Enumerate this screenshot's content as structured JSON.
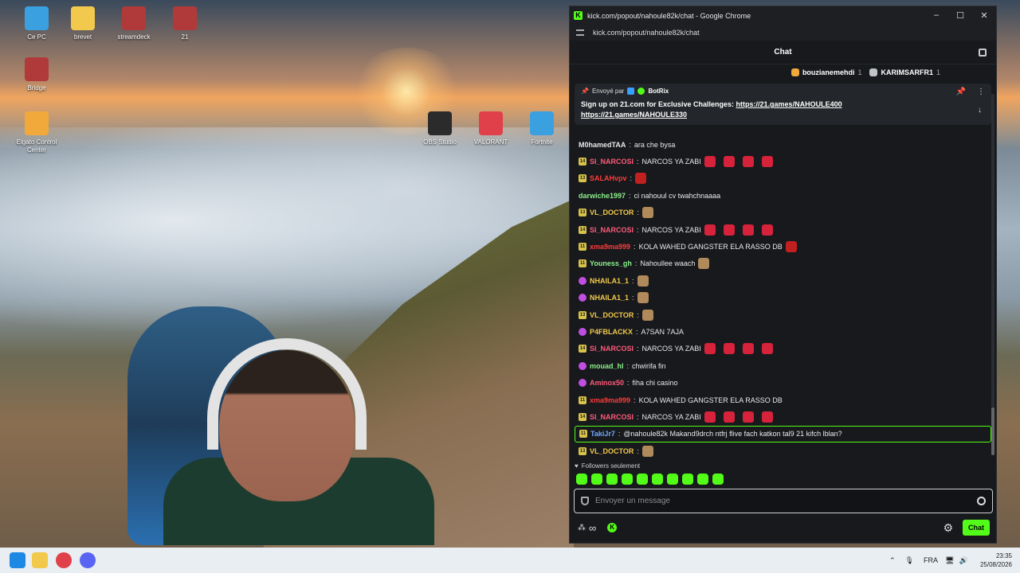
{
  "desktop": {
    "icons": [
      {
        "label": "Ce PC",
        "color": "#3aa0e0"
      },
      {
        "label": "brevet",
        "color": "#f2c94c"
      },
      {
        "label": "streamdeck",
        "color": "#b03a3a"
      },
      {
        "label": "21",
        "color": "#b03a3a"
      },
      {
        "label": "Bridge",
        "color": "#b03a3a"
      },
      {
        "label": "Elgato Control Center",
        "color": "#f2a93b"
      },
      {
        "label": "OBS Studio",
        "color": "#2b2b2b"
      },
      {
        "label": "VALORANT",
        "color": "#e0404a"
      },
      {
        "label": "Fortnite",
        "color": "#3aa0e0"
      }
    ]
  },
  "browser": {
    "title": "kick.com/popout/nahoule82k/chat - Google Chrome",
    "url": "kick.com/popout/nahoule82k/chat"
  },
  "chat": {
    "header_title": "Chat",
    "leaderboard": [
      {
        "name": "bouzianemehdi",
        "rank": "1",
        "color": "#f2a93b"
      },
      {
        "name": "KARIMSARFR1",
        "rank": "1",
        "color": "#c0c4c8"
      }
    ],
    "pinned": {
      "sent_by": "Envoyé par",
      "author": "BotRix",
      "text": "Sign up on 21.com for Exclusive Challenges: ",
      "link1": "https://21.games/NAHOULE400",
      "link2": "https://21.games/NAHOULE330"
    },
    "messages": [
      {
        "badge": "",
        "user": "M0hamedTAA",
        "color": "#e8e8e8",
        "text": "ara che bysa",
        "emotes": 0
      },
      {
        "badge": "14",
        "user": "SI_NARCOSI",
        "color": "#ff5a7a",
        "text": "NARCOS YA ZABI",
        "emotes": 4
      },
      {
        "badge": "13",
        "user": "SALAHvpv",
        "color": "#ff3b3b",
        "text": "",
        "emotes": 1
      },
      {
        "badge": "",
        "user": "darwiche1997",
        "color": "#8cf08c",
        "text": "ci nahouul cv twahchnaaaa",
        "emotes": 0
      },
      {
        "badge": "13",
        "user": "VL_DOCTOR",
        "color": "#f2c94c",
        "text": "",
        "emotes": 1
      },
      {
        "badge": "14",
        "user": "SI_NARCOSI",
        "color": "#ff5a7a",
        "text": "NARCOS YA ZABI",
        "emotes": 4
      },
      {
        "badge": "11",
        "user": "xma9ma999",
        "color": "#ff3b3b",
        "text": "KOLA WAHED GANGSTER ELA RASSO DB",
        "emotes": 1
      },
      {
        "badge": "11",
        "user": "Youness_gh",
        "color": "#8cf08c",
        "text": "Nahoullee waach",
        "emotes": 1
      },
      {
        "badge": "p",
        "user": "NHAILA1_1",
        "color": "#f2c94c",
        "text": "",
        "emotes": 1
      },
      {
        "badge": "p",
        "user": "NHAILA1_1",
        "color": "#f2c94c",
        "text": "",
        "emotes": 1
      },
      {
        "badge": "13",
        "user": "VL_DOCTOR",
        "color": "#f2c94c",
        "text": "",
        "emotes": 1
      },
      {
        "badge": "p",
        "user": "P4FBLACKX",
        "color": "#f2c94c",
        "text": "A7SAN 7AJA",
        "emotes": 0
      },
      {
        "badge": "14",
        "user": "SI_NARCOSI",
        "color": "#ff5a7a",
        "text": "NARCOS YA ZABI",
        "emotes": 4
      },
      {
        "badge": "p",
        "user": "mouad_hl",
        "color": "#8cf08c",
        "text": "chwirifa fin",
        "emotes": 0
      },
      {
        "badge": "p",
        "user": "Aminox50",
        "color": "#ff5a7a",
        "text": "fiha chi casino",
        "emotes": 0
      },
      {
        "badge": "11",
        "user": "xma9ma999",
        "color": "#ff3b3b",
        "text": "KOLA WAHED GANGSTER ELA RASSO DB",
        "emotes": 0
      },
      {
        "badge": "14",
        "user": "SI_NARCOSI",
        "color": "#ff5a7a",
        "text": "NARCOS YA ZABI",
        "emotes": 4
      },
      {
        "badge": "11",
        "user": "TakiJr7",
        "color": "#6fa8ff",
        "text": "@nahoule82k Makand9drch ntfrj flive fach katkon tal9 21 kifch lblan?",
        "emotes": 0,
        "highlight": true
      },
      {
        "badge": "13",
        "user": "VL_DOCTOR",
        "color": "#f2c94c",
        "text": "",
        "emotes": 1
      }
    ],
    "followers_only": "Followers seulement",
    "input_placeholder": "Envoyer un message",
    "send_label": "Chat"
  },
  "taskbar": {
    "lang": "FRA",
    "time": "23:35",
    "date": "25/08/2026"
  }
}
